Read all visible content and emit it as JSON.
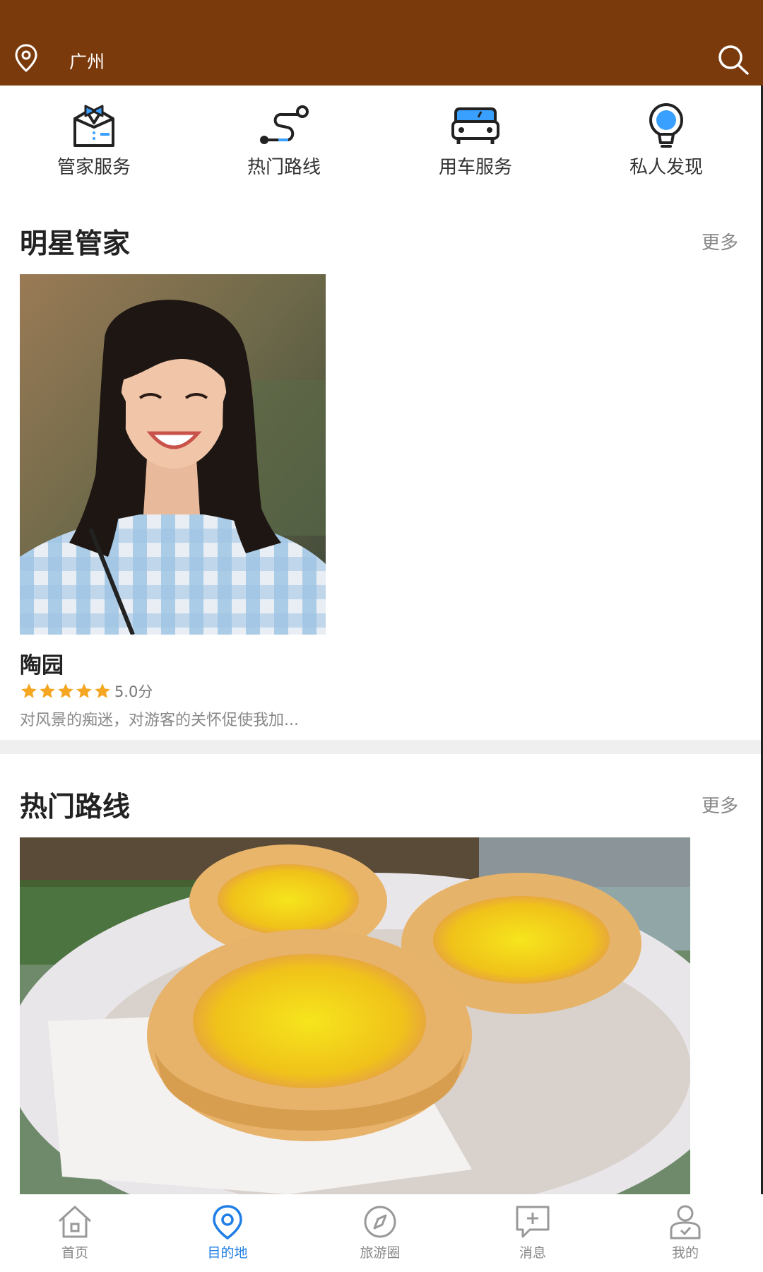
{
  "header": {
    "city": "广州",
    "bg_color": "#7b3a0c"
  },
  "quick_nav": [
    {
      "label": "管家服务",
      "icon": "butler-icon"
    },
    {
      "label": "热门路线",
      "icon": "route-icon"
    },
    {
      "label": "用车服务",
      "icon": "car-icon"
    },
    {
      "label": "私人发现",
      "icon": "lightbulb-icon"
    }
  ],
  "star_butler": {
    "title": "明星管家",
    "more": "更多",
    "card": {
      "name": "陶园",
      "rating": 5,
      "score_text": "5.0分",
      "description": "对风景的痴迷，对游客的关怀促使我加..."
    }
  },
  "hot_routes": {
    "title": "热门路线",
    "more": "更多"
  },
  "tabbar": {
    "active_color": "#1e7ee6",
    "items": [
      {
        "label": "首页",
        "icon": "home-icon"
      },
      {
        "label": "目的地",
        "icon": "location-icon",
        "active": true
      },
      {
        "label": "旅游圈",
        "icon": "compass-icon"
      },
      {
        "label": "消息",
        "icon": "message-icon"
      },
      {
        "label": "我的",
        "icon": "profile-icon"
      }
    ]
  }
}
